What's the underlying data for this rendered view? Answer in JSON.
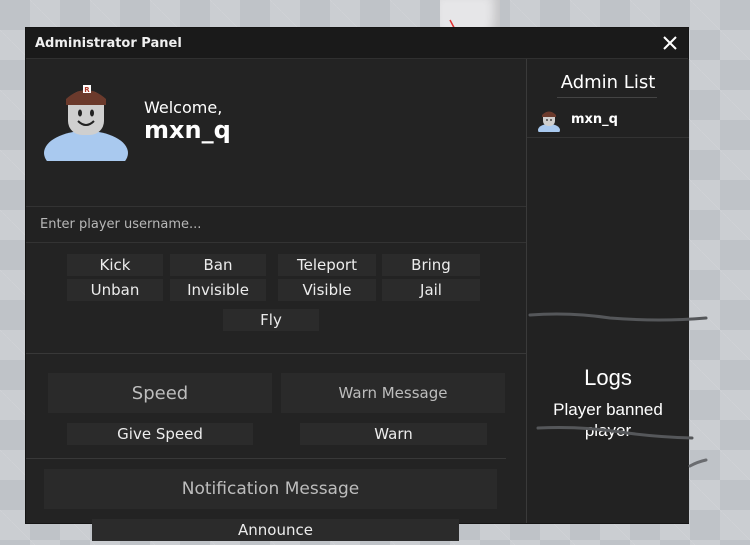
{
  "window": {
    "title": "Administrator Panel",
    "close_glyph": "✕"
  },
  "welcome": {
    "greeting": "Welcome,",
    "username": "mxn_q"
  },
  "player_input": {
    "placeholder": "Enter player username..."
  },
  "commands": [
    "Kick",
    "Ban",
    "Teleport",
    "Bring",
    "Unban",
    "Invisible",
    "Visible",
    "Jail",
    "Fly"
  ],
  "speed": {
    "field_placeholder": "Speed",
    "button": "Give Speed"
  },
  "warn": {
    "field_placeholder": "Warn Message",
    "button": "Warn"
  },
  "notification": {
    "field_placeholder": "Notification Message",
    "button": "Announce"
  },
  "admin_list": {
    "title": "Admin List",
    "admins": [
      {
        "name": "mxn_q"
      }
    ]
  },
  "logs": {
    "title": "Logs",
    "entries": [
      "Player banned player"
    ]
  },
  "icons": {
    "close": "close-icon",
    "avatar": "avatar-icon"
  },
  "colors": {
    "panel": "#232323",
    "titlebar": "#1a1a1a",
    "button": "#2b2b2b",
    "avatar_torso": "#a9c9ef"
  }
}
